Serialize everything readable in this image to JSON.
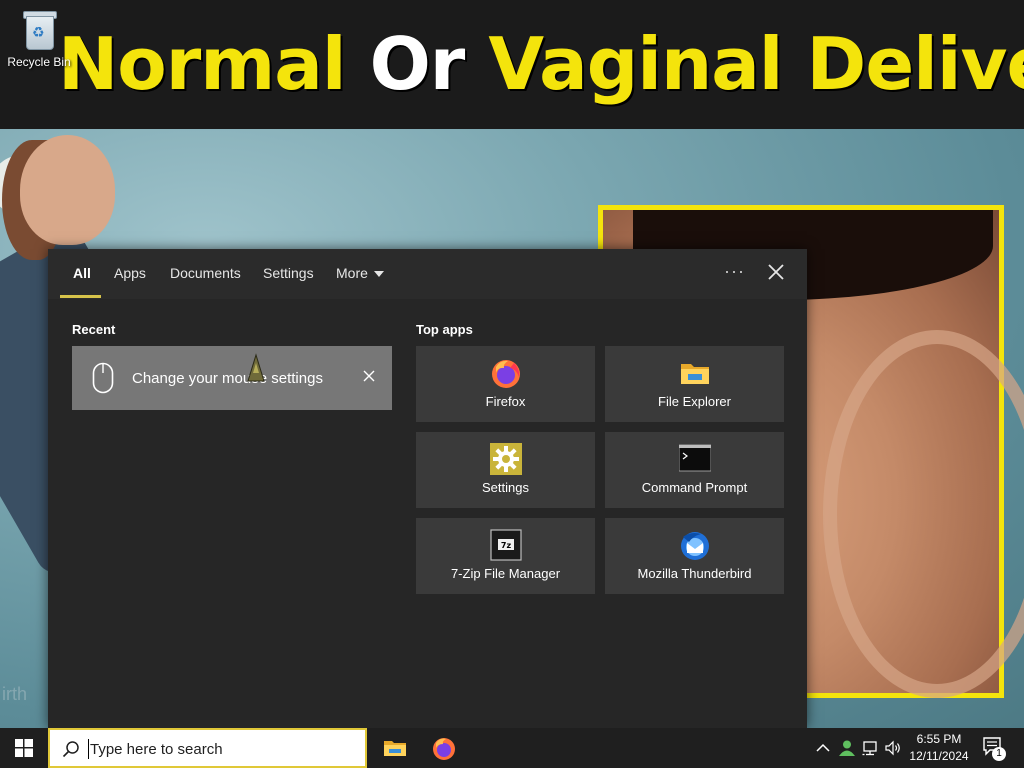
{
  "desktop": {
    "recycle_bin_label": "Recycle Bin",
    "wallpaper": {
      "title_part1": "Normal ",
      "title_part2": "Or ",
      "title_part3": "Vaginal Delivery",
      "corner_text": "irth"
    }
  },
  "search_panel": {
    "tabs": [
      {
        "label": "All",
        "active": true
      },
      {
        "label": "Apps"
      },
      {
        "label": "Documents"
      },
      {
        "label": "Settings"
      },
      {
        "label": "More"
      }
    ],
    "options_icon": "ellipsis-icon",
    "close_icon": "close-icon",
    "recent": {
      "title": "Recent",
      "items": [
        {
          "label": "Change your mouse settings",
          "icon": "mouse-icon",
          "remove_icon": "close-icon"
        }
      ]
    },
    "top_apps": {
      "title": "Top apps",
      "apps": [
        {
          "label": "Firefox",
          "icon": "firefox-icon"
        },
        {
          "label": "File Explorer",
          "icon": "folder-icon"
        },
        {
          "label": "Settings",
          "icon": "gear-icon"
        },
        {
          "label": "Command Prompt",
          "icon": "terminal-icon"
        },
        {
          "label": "7-Zip File Manager",
          "icon": "7zip-icon"
        },
        {
          "label": "Mozilla Thunderbird",
          "icon": "thunderbird-icon"
        }
      ]
    }
  },
  "taskbar": {
    "search_placeholder": "Type here to search",
    "pinned": [
      {
        "name": "File Explorer",
        "icon": "folder-icon"
      },
      {
        "name": "Firefox",
        "icon": "firefox-icon"
      }
    ],
    "tray": {
      "time": "6:55 PM",
      "date": "12/11/2024",
      "notification_count": "1"
    }
  },
  "colors": {
    "accent": "#d6c34a",
    "panel_bg": "#262626",
    "tile_bg": "#3a3a3a",
    "taskbar_bg": "#1f1f1f",
    "banner_yellow": "#f4e40c"
  }
}
